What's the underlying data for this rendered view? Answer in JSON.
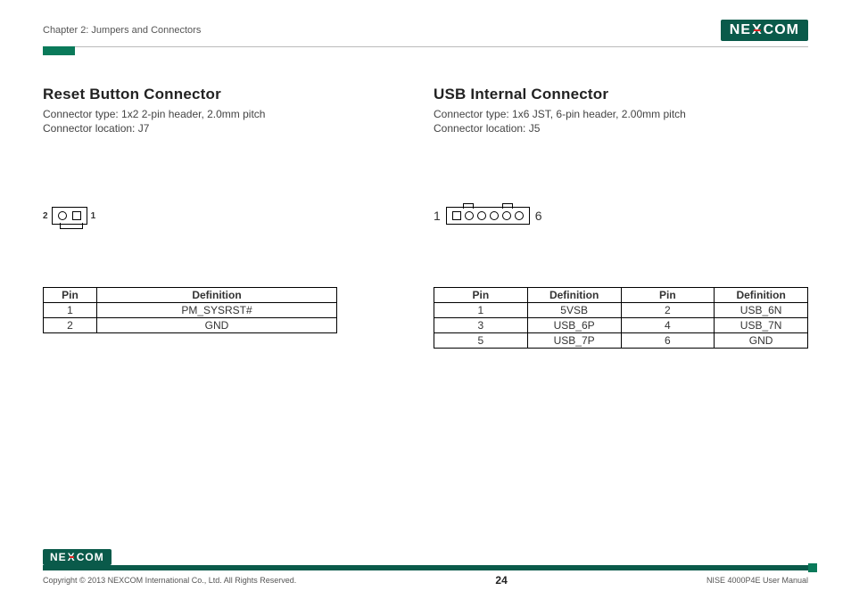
{
  "header": {
    "chapter": "Chapter 2: Jumpers and Connectors",
    "brand_left": "NE",
    "brand_x": "X",
    "brand_right": "COM"
  },
  "left": {
    "title": "Reset Button Connector",
    "type_line": "Connector type: 1x2 2-pin header, 2.0mm pitch",
    "loc_line": "Connector location: J7",
    "pin_left_label": "2",
    "pin_right_label": "1",
    "table": {
      "h_pin": "Pin",
      "h_def": "Definition",
      "rows": [
        {
          "pin": "1",
          "def": "PM_SYSRST#"
        },
        {
          "pin": "2",
          "def": "GND"
        }
      ]
    }
  },
  "right": {
    "title": "USB Internal Connector",
    "type_line": "Connector type: 1x6 JST, 6-pin header, 2.00mm pitch",
    "loc_line": "Connector location: J5",
    "pin_left_label": "1",
    "pin_right_label": "6",
    "table": {
      "h_pin": "Pin",
      "h_def": "Definition",
      "rows": [
        {
          "p1": "1",
          "d1": "5VSB",
          "p2": "2",
          "d2": "USB_6N"
        },
        {
          "p1": "3",
          "d1": "USB_6P",
          "p2": "4",
          "d2": "USB_7N"
        },
        {
          "p1": "5",
          "d1": "USB_7P",
          "p2": "6",
          "d2": "GND"
        }
      ]
    }
  },
  "footer": {
    "copyright": "Copyright © 2013 NEXCOM International Co., Ltd. All Rights Reserved.",
    "page": "24",
    "manual": "NISE 4000P4E User Manual"
  }
}
